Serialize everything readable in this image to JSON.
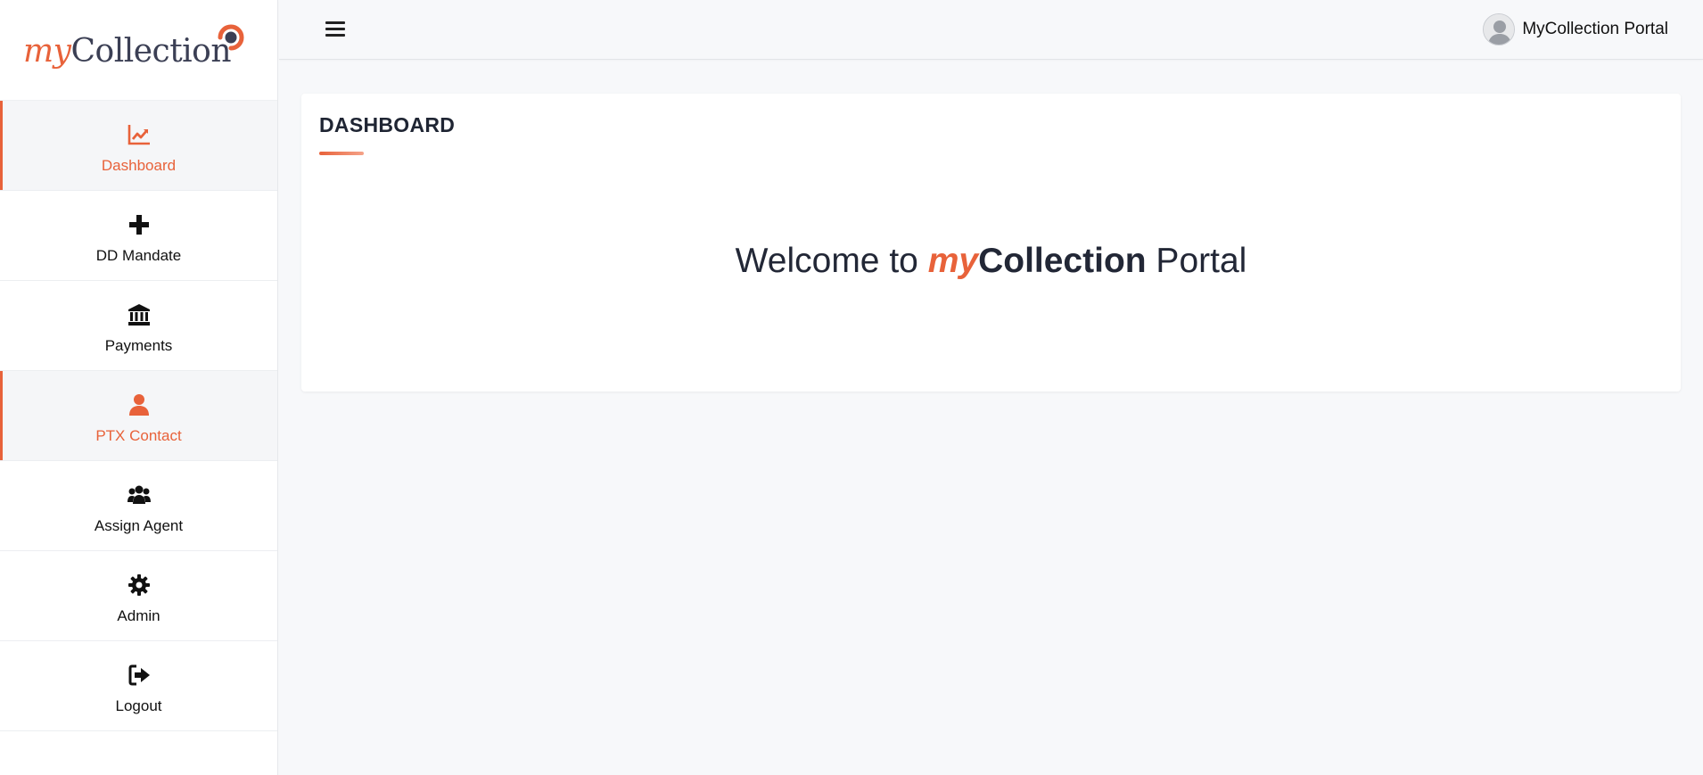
{
  "brand": {
    "logo_my": "my",
    "logo_collection": "Collection",
    "accent_color": "#e8623a"
  },
  "sidebar": {
    "items": [
      {
        "label": "Dashboard",
        "icon": "chart-line-icon",
        "active": true
      },
      {
        "label": "DD Mandate",
        "icon": "plus-icon",
        "active": false
      },
      {
        "label": "Payments",
        "icon": "bank-icon",
        "active": false
      },
      {
        "label": "PTX Contact",
        "icon": "user-icon",
        "active": true
      },
      {
        "label": "Assign Agent",
        "icon": "users-icon",
        "active": false
      },
      {
        "label": "Admin",
        "icon": "gear-icon",
        "active": false
      },
      {
        "label": "Logout",
        "icon": "sign-out-icon",
        "active": false
      }
    ]
  },
  "header": {
    "menu_icon": "hamburger-icon",
    "user_name": "MyCollection Portal",
    "avatar_icon": "avatar-icon"
  },
  "main": {
    "title": "DASHBOARD",
    "welcome_prefix": "Welcome to ",
    "welcome_my": "my",
    "welcome_collection": "Collection",
    "welcome_suffix": " Portal"
  }
}
